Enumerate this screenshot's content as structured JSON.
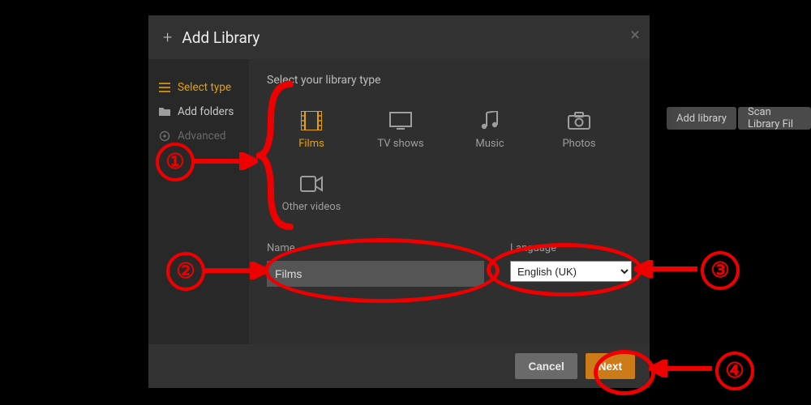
{
  "page_buttons": {
    "add_library": "Add library",
    "scan_library": "Scan Library Fil"
  },
  "modal": {
    "title": "Add Library",
    "close_glyph": "×",
    "sidebar": {
      "select_type": "Select type",
      "add_folders": "Add folders",
      "advanced": "Advanced"
    },
    "prompt": "Select your library type",
    "types": {
      "films": "Films",
      "tv": "TV shows",
      "music": "Music",
      "photos": "Photos",
      "other": "Other videos"
    },
    "fields": {
      "name_label": "Name",
      "name_value": "Films",
      "language_label": "Language",
      "language_value": "English (UK)"
    },
    "footer": {
      "cancel": "Cancel",
      "next": "Next"
    }
  },
  "annotations": {
    "n1": "①",
    "n2": "②",
    "n3": "③",
    "n4": "④"
  }
}
